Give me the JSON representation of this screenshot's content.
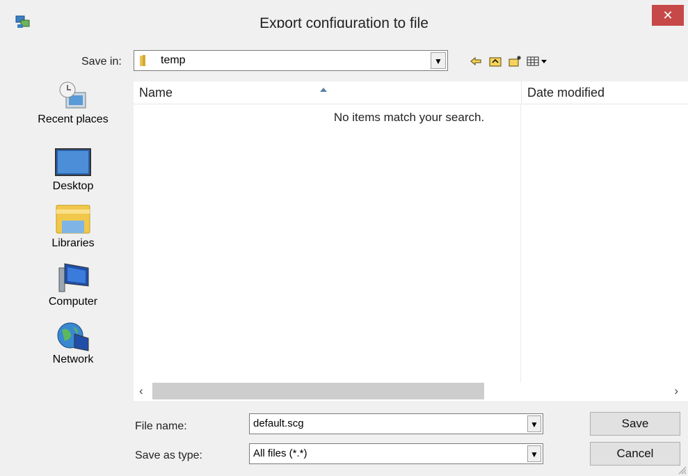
{
  "window": {
    "title": "Export configuration to file",
    "close_label": "✕"
  },
  "save_in": {
    "label": "Save in:",
    "value": "temp"
  },
  "toolbar": {
    "icons": [
      "back-icon",
      "up-folder-icon",
      "new-folder-icon",
      "view-menu-icon"
    ]
  },
  "places": [
    {
      "label": "Recent places",
      "icon": "recent-places-icon"
    },
    {
      "label": "Desktop",
      "icon": "desktop-icon"
    },
    {
      "label": "Libraries",
      "icon": "libraries-icon"
    },
    {
      "label": "Computer",
      "icon": "computer-icon"
    },
    {
      "label": "Network",
      "icon": "network-icon"
    }
  ],
  "list": {
    "columns": [
      "Name",
      "Date modified"
    ],
    "empty_message": "No items match your search."
  },
  "file_name": {
    "label": "File name:",
    "value": "default.scg"
  },
  "save_as_type": {
    "label": "Save as type:",
    "value": "All files (*.*)"
  },
  "buttons": {
    "save": "Save",
    "cancel": "Cancel"
  },
  "colors": {
    "close_button": "#c74848",
    "dialog_bg": "#f0f0f0"
  }
}
